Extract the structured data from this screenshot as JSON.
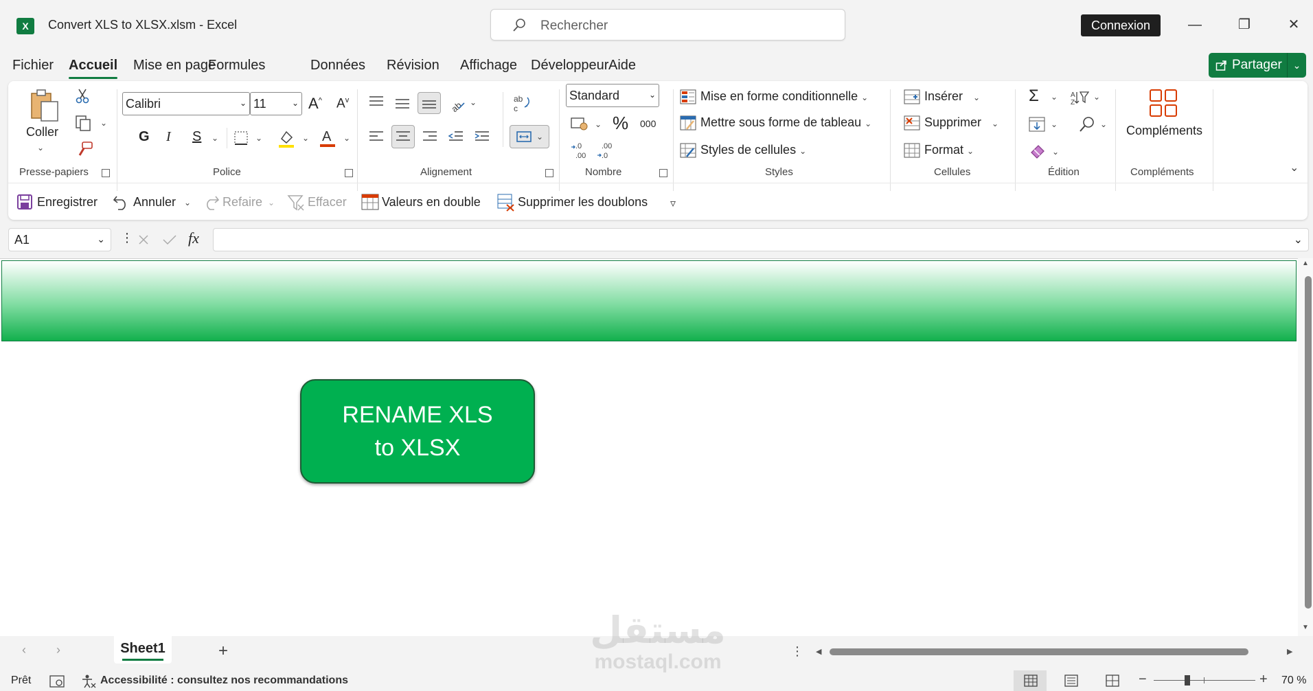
{
  "titlebar": {
    "doc_title": "Convert XLS to XLSX.xlsm  -  Excel",
    "search_placeholder": "Rechercher",
    "signin": "Connexion",
    "minimize": "—",
    "restore": "❐",
    "close": "✕"
  },
  "menu": {
    "tabs": [
      "Fichier",
      "Accueil",
      "Mise en page",
      "Formules",
      "Données",
      "Révision",
      "Affichage",
      "Développeur",
      "Aide"
    ],
    "active": "Accueil",
    "share": "Partager"
  },
  "ribbon": {
    "clipboard": {
      "paste": "Coller",
      "label": "Presse-papiers"
    },
    "font": {
      "name": "Calibri",
      "size": "11",
      "bold": "G",
      "italic": "I",
      "underline": "S",
      "label": "Police"
    },
    "alignment": {
      "label": "Alignement"
    },
    "number": {
      "format": "Standard",
      "percent": "%",
      "thousands": "000",
      "label": "Nombre"
    },
    "styles": {
      "conditional": "Mise en forme conditionnelle",
      "table": "Mettre sous forme de tableau",
      "cell_styles": "Styles de cellules",
      "label": "Styles"
    },
    "cells": {
      "insert": "Insérer",
      "delete": "Supprimer",
      "format": "Format",
      "label": "Cellules"
    },
    "editing": {
      "label": "Édition"
    },
    "addins": {
      "button": "Compléments",
      "label": "Compléments"
    }
  },
  "qat": {
    "save": "Enregistrer",
    "undo": "Annuler",
    "redo": "Refaire",
    "clear": "Effacer",
    "duplicates": "Valeurs en double",
    "remove_duplicates": "Supprimer les doublons"
  },
  "formula_bar": {
    "name_box": "A1",
    "fx": "fx",
    "value": ""
  },
  "sheet": {
    "button_line1": "RENAME XLS",
    "button_line2": "to XLSX"
  },
  "sheet_tabs": {
    "active": "Sheet1",
    "add": "+"
  },
  "status": {
    "ready": "Prêt",
    "accessibility": "Accessibilité : consultez nos recommandations",
    "zoom": "70 %",
    "zoom_value": 0.7
  },
  "watermark": {
    "arabic": "مستقل",
    "latin": "mostaql.com"
  },
  "colors": {
    "accent": "#107c41",
    "button": "#00b050"
  }
}
